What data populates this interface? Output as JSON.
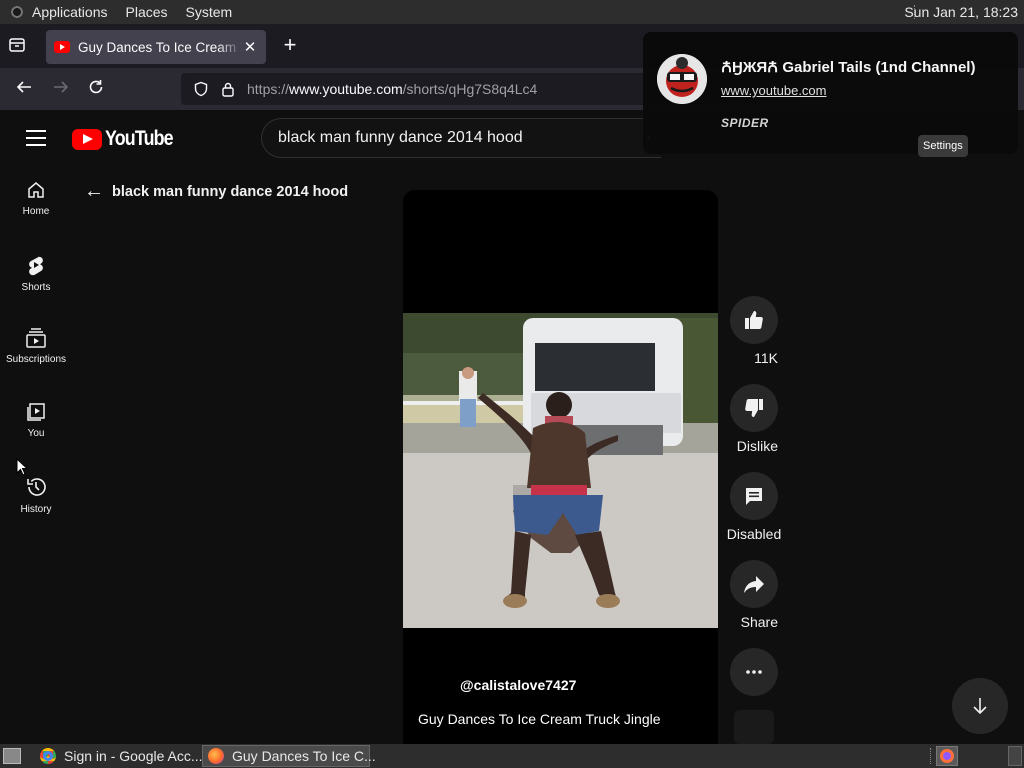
{
  "top_panel": {
    "menus": [
      "Applications",
      "Places",
      "System"
    ],
    "clock": "Sun Jan 21, 18:23"
  },
  "browser": {
    "tab_title": "Guy Dances To Ice Cream Truck Jingle",
    "url_prefix": "https://",
    "url_host": "www.youtube.com",
    "url_path": "/shorts/qHg7S8q4Lc4"
  },
  "youtube": {
    "logo_text": "YouTube",
    "search_query": "black man funny dance 2014 hood",
    "guide": [
      {
        "label": "Home",
        "icon": "home-icon"
      },
      {
        "label": "Shorts",
        "icon": "shorts-icon"
      },
      {
        "label": "Subscriptions",
        "icon": "subscriptions-icon"
      },
      {
        "label": "You",
        "icon": "you-icon"
      },
      {
        "label": "History",
        "icon": "history-icon"
      }
    ],
    "back_title": "black man funny dance 2014 hood",
    "channel_handle": "@calistalove7427",
    "video_title": "Guy Dances To Ice Cream Truck Jingle",
    "actions": {
      "like": "11K",
      "dislike": "Dislike",
      "comments": "Disabled",
      "share": "Share"
    }
  },
  "notification": {
    "title": "ꙈӇЖЯꙈ Gabriel Tails (1nd Channel)",
    "link": "www.youtube.com",
    "label": "SPIDER"
  },
  "tooltip": "Settings",
  "taskbar": {
    "tasks": [
      "Sign in - Google Acc...",
      "Guy Dances To Ice C..."
    ]
  }
}
